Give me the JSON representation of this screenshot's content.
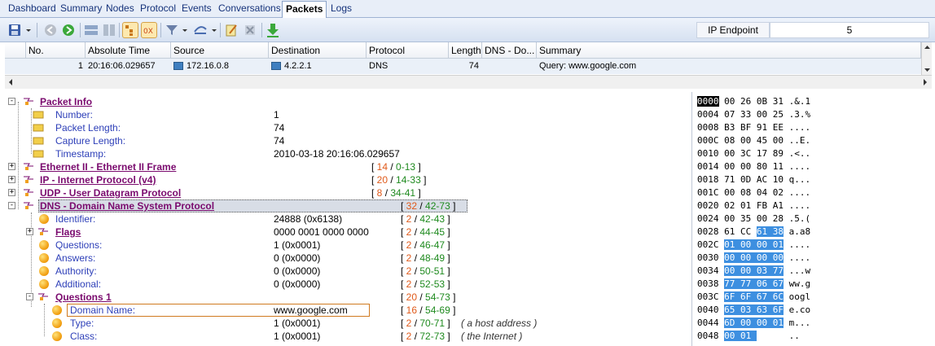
{
  "tabs": [
    "Dashboard",
    "Summary",
    "Nodes",
    "Protocol",
    "Events",
    "Conversations",
    "Packets",
    "Logs"
  ],
  "active_tab": "Packets",
  "ip_endpoint": {
    "label": "IP Endpoint",
    "value": "5"
  },
  "grid": {
    "headers": [
      "No.",
      "Absolute Time",
      "Source",
      "Destination",
      "Protocol",
      "Length",
      "DNS - Do...",
      "Summary"
    ],
    "row": {
      "no": "1",
      "time": "20:16:06.029657",
      "source": "172.16.0.8",
      "destination": "4.2.2.1",
      "protocol": "DNS",
      "length": "74",
      "dns": "",
      "summary": "Query: www.google.com"
    }
  },
  "tree": {
    "packet_info": {
      "title": "Packet Info",
      "fields": [
        {
          "name": "Number:",
          "value": "1"
        },
        {
          "name": "Packet Length:",
          "value": "74"
        },
        {
          "name": "Capture Length:",
          "value": "74"
        },
        {
          "name": "Timestamp:",
          "value": "2010-03-18 20:16:06.029657"
        }
      ]
    },
    "ethernet": {
      "title": "Ethernet II - Ethernet II Frame",
      "len": "14",
      "range": "0-13"
    },
    "ip": {
      "title": "IP - Internet Protocol (v4)",
      "len": "20",
      "range": "14-33"
    },
    "udp": {
      "title": "UDP - User Datagram Protocol",
      "len": "8",
      "range": "34-41"
    },
    "dns": {
      "title": "DNS - Domain Name System Protocol",
      "len": "32",
      "range": "42-73",
      "fields": [
        {
          "name": "Identifier:",
          "value": "24888 (0x6138)",
          "len": "2",
          "range": "42-43"
        },
        {
          "name": "Flags",
          "value": "0000 0001 0000 0000",
          "len": "2",
          "range": "44-45"
        },
        {
          "name": "Questions:",
          "value": "1 (0x0001)",
          "len": "2",
          "range": "46-47"
        },
        {
          "name": "Answers:",
          "value": "0 (0x0000)",
          "len": "2",
          "range": "48-49"
        },
        {
          "name": "Authority:",
          "value": "0 (0x0000)",
          "len": "2",
          "range": "50-51"
        },
        {
          "name": "Additional:",
          "value": "0 (0x0000)",
          "len": "2",
          "range": "52-53"
        }
      ],
      "questions": {
        "title": "Questions 1",
        "len": "20",
        "range": "54-73",
        "fields": [
          {
            "name": "Domain Name:",
            "value": "www.google.com",
            "len": "16",
            "range": "54-69",
            "note": ""
          },
          {
            "name": "Type:",
            "value": "1 (0x0001)",
            "len": "2",
            "range": "70-71",
            "note": "( a host address )"
          },
          {
            "name": "Class:",
            "value": "1 (0x0001)",
            "len": "2",
            "range": "72-73",
            "note": "( the Internet )"
          }
        ]
      }
    }
  },
  "hex": [
    {
      "off": "0000",
      "b": [
        "00",
        "26",
        "0B",
        "31"
      ],
      "a": ".&.1"
    },
    {
      "off": "0004",
      "b": [
        "07",
        "33",
        "00",
        "25"
      ],
      "a": ".3.%"
    },
    {
      "off": "0008",
      "b": [
        "B3",
        "BF",
        "91",
        "EE"
      ],
      "a": "...."
    },
    {
      "off": "000C",
      "b": [
        "08",
        "00",
        "45",
        "00"
      ],
      "a": "..E."
    },
    {
      "off": "0010",
      "b": [
        "00",
        "3C",
        "17",
        "89"
      ],
      "a": ".<.."
    },
    {
      "off": "0014",
      "b": [
        "00",
        "00",
        "80",
        "11"
      ],
      "a": "...."
    },
    {
      "off": "0018",
      "b": [
        "71",
        "0D",
        "AC",
        "10"
      ],
      "a": "q..."
    },
    {
      "off": "001C",
      "b": [
        "00",
        "08",
        "04",
        "02"
      ],
      "a": "...."
    },
    {
      "off": "0020",
      "b": [
        "02",
        "01",
        "FB",
        "A1"
      ],
      "a": "...."
    },
    {
      "off": "0024",
      "b": [
        "00",
        "35",
        "00",
        "28"
      ],
      "a": ".5.("
    },
    {
      "off": "0028",
      "b": [
        "61",
        "CC",
        "61",
        "38"
      ],
      "a": "a.a8"
    },
    {
      "off": "002C",
      "b": [
        "01",
        "00",
        "00",
        "01"
      ],
      "a": "...."
    },
    {
      "off": "0030",
      "b": [
        "00",
        "00",
        "00",
        "00"
      ],
      "a": "...."
    },
    {
      "off": "0034",
      "b": [
        "00",
        "00",
        "03",
        "77"
      ],
      "a": "...w"
    },
    {
      "off": "0038",
      "b": [
        "77",
        "77",
        "06",
        "67"
      ],
      "a": "ww.g"
    },
    {
      "off": "003C",
      "b": [
        "6F",
        "6F",
        "67",
        "6C"
      ],
      "a": "oogl"
    },
    {
      "off": "0040",
      "b": [
        "65",
        "03",
        "63",
        "6F"
      ],
      "a": "e.co"
    },
    {
      "off": "0044",
      "b": [
        "6D",
        "00",
        "00",
        "01"
      ],
      "a": "m..."
    },
    {
      "off": "0048",
      "b": [
        "00",
        "01",
        "",
        ""
      ],
      "a": ".."
    }
  ]
}
